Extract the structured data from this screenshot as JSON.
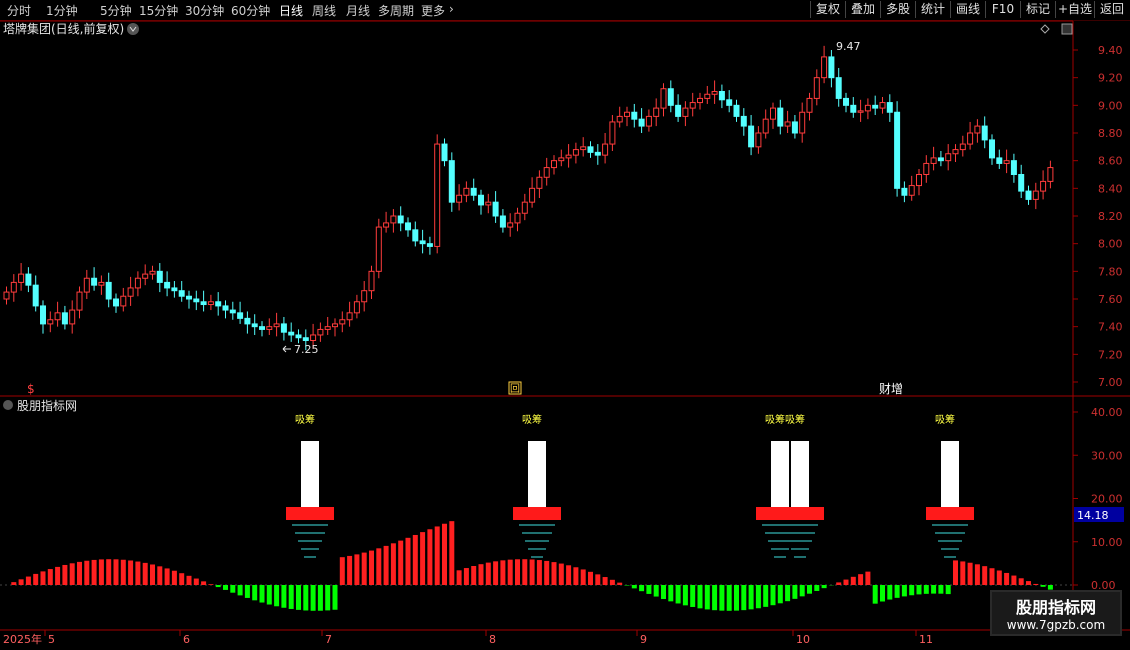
{
  "toolbar": {
    "periods": [
      "分时",
      "1分钟",
      "5分钟",
      "15分钟",
      "30分钟",
      "60分钟",
      "日线",
      "周线",
      "月线",
      "多周期",
      "更多"
    ],
    "active_period": "日线",
    "more_chevron": "›",
    "right_buttons": [
      "复权",
      "叠加",
      "多股",
      "统计",
      "画线",
      "F10",
      "标记",
      "+自选",
      "返回"
    ]
  },
  "main_panel": {
    "title": "塔牌集团(日线,前复权)",
    "price_ticks": [
      "9.40",
      "9.20",
      "9.00",
      "8.80",
      "8.60",
      "8.40",
      "8.20",
      "8.00",
      "7.80",
      "7.60",
      "7.40",
      "7.20",
      "7.00"
    ],
    "high_label": "9.47",
    "low_label": "7.25",
    "marker_dollar": "$",
    "marker_hui": "回",
    "marker_caizeng": "财增"
  },
  "indicator_panel": {
    "title": "股朋指标网",
    "y_ticks": [
      "40.00",
      "30.00",
      "20.00",
      "10.00",
      "0.00"
    ],
    "current_value": "14.18",
    "signal_text": "吸筹"
  },
  "date_axis": {
    "year_label": "2025年",
    "months": [
      "5",
      "6",
      "7",
      "8",
      "9",
      "10",
      "11"
    ]
  },
  "watermark": {
    "line1": "股朋指标网",
    "line2": "www.7gpzb.com"
  },
  "colors": {
    "up": "#ff3c3c",
    "down": "#54ffff",
    "axis": "#a00000",
    "signal": "#ffff44",
    "hist_up": "#ff2020",
    "hist_down": "#00ff00"
  },
  "chart_data": {
    "type": "candlestick",
    "title": "塔牌集团(日线,前复权)",
    "ylim": [
      7.0,
      9.5
    ],
    "high": 9.47,
    "low": 7.25,
    "close": [
      7.65,
      7.72,
      7.78,
      7.7,
      7.55,
      7.42,
      7.45,
      7.5,
      7.42,
      7.52,
      7.65,
      7.75,
      7.7,
      7.72,
      7.6,
      7.55,
      7.62,
      7.68,
      7.75,
      7.78,
      7.8,
      7.72,
      7.68,
      7.66,
      7.62,
      7.6,
      7.58,
      7.56,
      7.58,
      7.55,
      7.52,
      7.5,
      7.46,
      7.42,
      7.4,
      7.38,
      7.4,
      7.42,
      7.36,
      7.34,
      7.32,
      7.3,
      7.34,
      7.38,
      7.4,
      7.42,
      7.45,
      7.5,
      7.58,
      7.66,
      7.8,
      8.12,
      8.15,
      8.2,
      8.15,
      8.1,
      8.02,
      8.0,
      7.98,
      8.72,
      8.6,
      8.3,
      8.35,
      8.4,
      8.35,
      8.28,
      8.3,
      8.2,
      8.12,
      8.15,
      8.22,
      8.3,
      8.4,
      8.48,
      8.55,
      8.6,
      8.62,
      8.64,
      8.68,
      8.7,
      8.66,
      8.64,
      8.72,
      8.88,
      8.92,
      8.95,
      8.9,
      8.85,
      8.92,
      8.98,
      9.12,
      9.0,
      8.92,
      8.98,
      9.02,
      9.05,
      9.08,
      9.1,
      9.04,
      9.0,
      8.92,
      8.85,
      8.7,
      8.8,
      8.9,
      8.98,
      8.85,
      8.88,
      8.8,
      8.95,
      9.05,
      9.2,
      9.35,
      9.2,
      9.05,
      9.0,
      8.95,
      8.96,
      9.0,
      8.98,
      9.02,
      8.95,
      8.4,
      8.35,
      8.42,
      8.5,
      8.58,
      8.62,
      8.6,
      8.65,
      8.68,
      8.72,
      8.8,
      8.85,
      8.75,
      8.62,
      8.58,
      8.6,
      8.5,
      8.38,
      8.32,
      8.38,
      8.45,
      8.55
    ]
  }
}
